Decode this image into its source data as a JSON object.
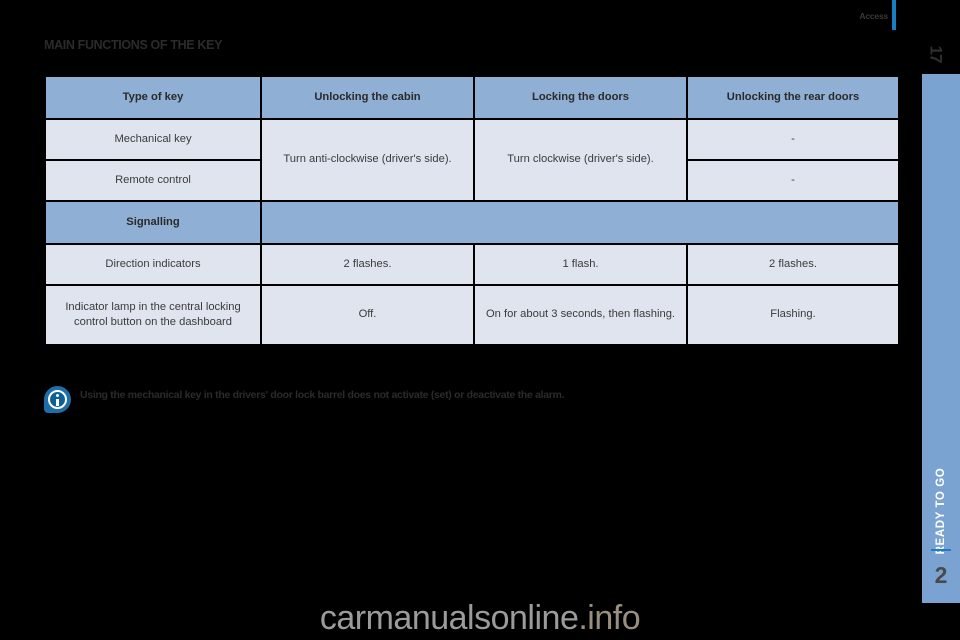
{
  "document": {
    "running_head": "Access",
    "folio": "17",
    "section_title": "MAIN FUNCTIONS OF THE KEY"
  },
  "table": {
    "columns": [
      "Type of key",
      "Unlocking the cabin",
      "Locking the doors",
      "Unlocking the rear doors"
    ],
    "rows": [
      {
        "label": "Mechanical key",
        "unlocking_cabin": "Turn anti-clockwise (driver's side).",
        "locking_doors": "Turn clockwise (driver's side).",
        "unlocking_rear": "-"
      },
      {
        "label": "Remote control",
        "unlocking_rear": "-"
      }
    ],
    "signalling_header": "Signalling",
    "signalling_rows": [
      {
        "label": "Direction indicators",
        "unlocking_cabin": "2 flashes.",
        "locking_doors": "1 flash.",
        "unlocking_rear": "2 flashes."
      },
      {
        "label": "Indicator lamp in the central locking control button on the dashboard",
        "unlocking_cabin": "Off.",
        "locking_doors": "On for about 3 seconds, then flashing.",
        "unlocking_rear": "Flashing."
      }
    ]
  },
  "note": {
    "icon": "info-icon",
    "text": "Using the mechanical key in the drivers' door lock barrel does not activate (set) or deactivate the alarm."
  },
  "chapter_tab": {
    "name": "READY TO GO",
    "number": "2"
  },
  "watermark": {
    "main": "carmanualsonline",
    "suffix": ".info"
  },
  "colors": {
    "header_blue": "#8fafd4",
    "cell_blue": "#dfe4ef",
    "tab_blue": "#7ba3d2",
    "accent_blue": "#1a7ec2",
    "page_background": "#000000"
  }
}
